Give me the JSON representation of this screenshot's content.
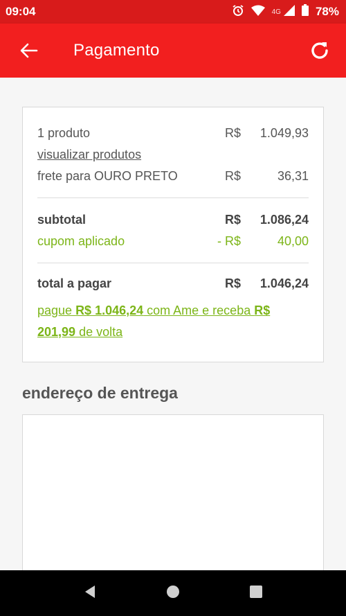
{
  "status_bar": {
    "time": "09:04",
    "network": "4G",
    "battery": "78%"
  },
  "header": {
    "title": "Pagamento",
    "back_icon": "arrow-left-icon",
    "refresh_icon": "refresh-icon"
  },
  "summary": {
    "products": {
      "label": "1 produto",
      "currency": "R$",
      "value": "1.049,93"
    },
    "view_products_link": "visualizar produtos",
    "shipping": {
      "label": "frete para OURO PRETO",
      "currency": "R$",
      "value": "36,31"
    },
    "subtotal": {
      "label": "subtotal",
      "currency": "R$",
      "value": "1.086,24"
    },
    "coupon": {
      "label": "cupom aplicado",
      "currency": "- R$",
      "value": "40,00"
    },
    "total": {
      "label": "total a pagar",
      "currency": "R$",
      "value": "1.046,24"
    },
    "ame_offer": {
      "part1": "pague ",
      "amount_pay": "R$ 1.046,24",
      "part2": " com Ame e receba ",
      "amount_back": "R$ 201,99",
      "part3": " de volta"
    }
  },
  "delivery": {
    "title": "endereço de entrega"
  },
  "colors": {
    "brand_red": "#f21f1f",
    "status_red": "#d81b1b",
    "ame_green": "#7cb518"
  }
}
